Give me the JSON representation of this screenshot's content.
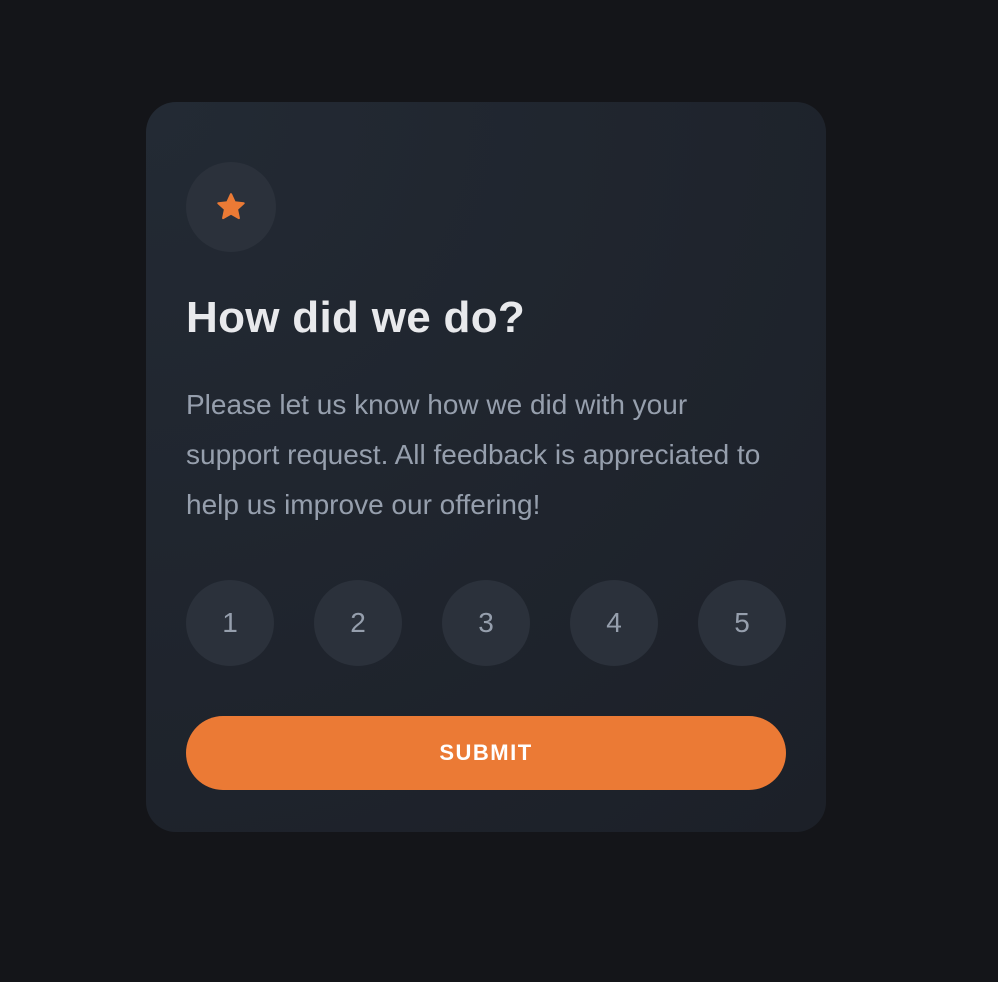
{
  "card": {
    "icon": "star-icon",
    "title": "How did we do?",
    "description": "Please let us know how we did with your support request. All feedback is appreciated to help us improve our offering!",
    "ratings": [
      "1",
      "2",
      "3",
      "4",
      "5"
    ],
    "submit_label": "SUBMIT"
  },
  "colors": {
    "page_background": "#141519",
    "card_background": "#1e232b",
    "circle_background": "#2b313b",
    "accent": "#eb7a35",
    "title_text": "#e8e9ec",
    "muted_text": "#969fad"
  }
}
